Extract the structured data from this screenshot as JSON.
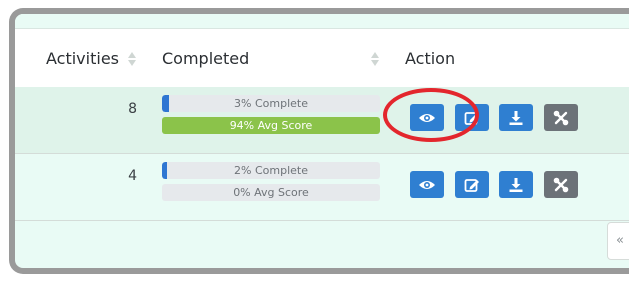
{
  "table": {
    "headers": {
      "activities": "Activities",
      "completed": "Completed",
      "action": "Action"
    },
    "rows": [
      {
        "activities": "8",
        "progress_label": "3% Complete",
        "progress_value": 0.03,
        "score_label": "94% Avg Score",
        "score_value": 0.94
      },
      {
        "activities": "4",
        "progress_label": "2% Complete",
        "progress_value": 0.02,
        "score_label": "0% Avg Score",
        "score_value": 0.0
      }
    ],
    "actions": [
      "view-icon",
      "edit-icon",
      "download-icon",
      "unlink-icon"
    ]
  },
  "pagination": {
    "prev_label": "«"
  },
  "colors": {
    "primary": "#2f7fd1",
    "score_green": "#8bc34a",
    "row_highlight": "#dff3ea",
    "annotation": "#e3262d"
  }
}
